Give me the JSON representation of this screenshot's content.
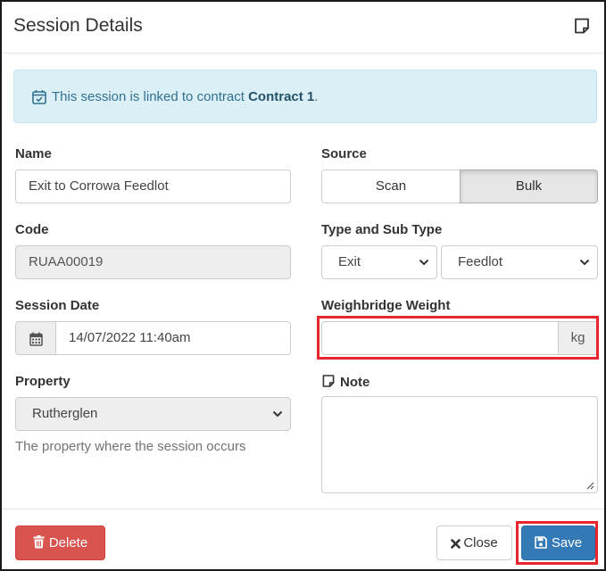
{
  "modal": {
    "title": "Session Details"
  },
  "alert": {
    "prefix": "This session is linked to contract ",
    "contract": "Contract 1",
    "suffix": "."
  },
  "form": {
    "name_label": "Name",
    "name_value": "Exit to Corrowa Feedlot",
    "source_label": "Source",
    "source_options": [
      "Scan",
      "Bulk"
    ],
    "source_selected": "Bulk",
    "code_label": "Code",
    "code_value": "RUAA00019",
    "type_label": "Type and Sub Type",
    "type_value": "Exit",
    "subtype_value": "Feedlot",
    "session_date_label": "Session Date",
    "session_date_value": "14/07/2022 11:40am",
    "weighbridge_label": "Weighbridge Weight",
    "weighbridge_value": "",
    "weight_unit": "kg",
    "property_label": "Property",
    "property_value": "Rutherglen",
    "property_help": "The property where the session occurs",
    "note_label": "Note",
    "note_value": ""
  },
  "footer": {
    "delete_label": "Delete",
    "close_label": "Close",
    "save_label": "Save"
  },
  "colors": {
    "alert_bg": "#dbeff7",
    "alert_text": "#31708f",
    "danger": "#d9534f",
    "primary": "#337ab7",
    "highlight": "#e8262c"
  },
  "icons": {
    "header": "note-icon",
    "alert": "calendar-check-icon",
    "date": "calendar-icon",
    "note": "note-icon",
    "delete": "trash-icon",
    "close": "close-icon",
    "save": "floppy-disk-icon"
  }
}
